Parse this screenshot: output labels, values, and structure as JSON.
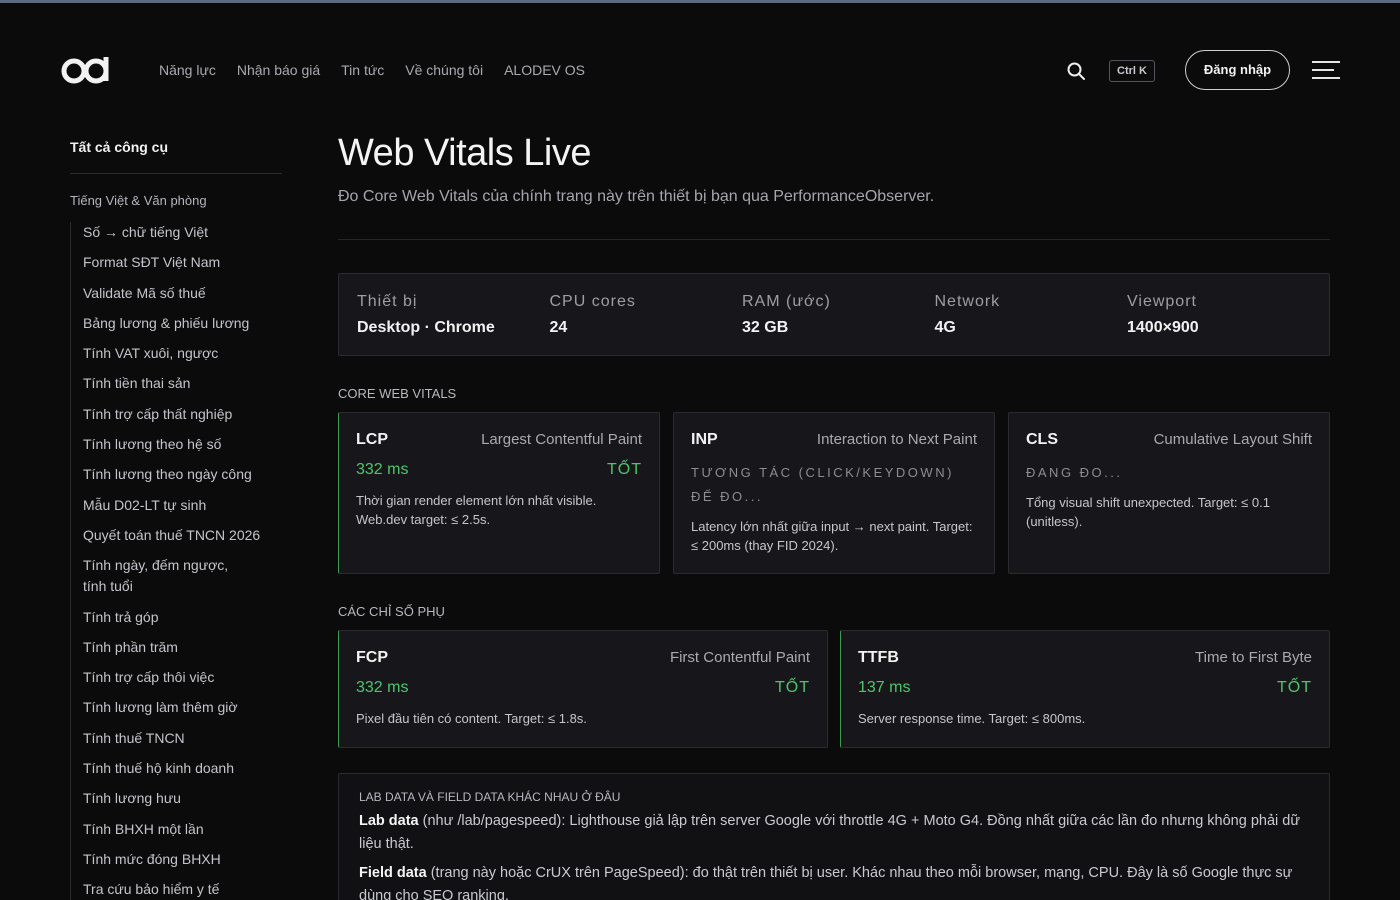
{
  "nav": {
    "items": [
      "Năng lực",
      "Nhận báo giá",
      "Tin tức",
      "Về chúng tôi",
      "ALODEV OS"
    ],
    "shortcut": "Ctrl K",
    "login": "Đăng nhập"
  },
  "sidebar": {
    "title": "Tất cả công cụ",
    "group": "Tiếng Việt & Văn phòng",
    "items": [
      "Số → chữ tiếng Việt",
      "Format SĐT Việt Nam",
      "Validate Mã số thuế",
      "Bảng lương & phiếu lương",
      "Tính VAT xuôi, ngược",
      "Tính tiền thai sản",
      "Tính trợ cấp thất nghiệp",
      "Tính lương theo hệ số",
      "Tính lương theo ngày công",
      "Mẫu D02-LT tự sinh",
      "Quyết toán thuế TNCN 2026",
      "Tính ngày, đếm ngược, tính tuổi",
      "Tính trả góp",
      "Tính phần trăm",
      "Tính trợ cấp thôi việc",
      "Tính lương làm thêm giờ",
      "Tính thuế TNCN",
      "Tính thuế hộ kinh doanh",
      "Tính lương hưu",
      "Tính BHXH một lần",
      "Tính mức đóng BHXH",
      "Tra cứu bảo hiểm y tế"
    ]
  },
  "page": {
    "title": "Web Vitals Live",
    "subtitle": "Đo Core Web Vitals của chính trang này trên thiết bị bạn qua PerformanceObserver."
  },
  "device": [
    {
      "label": "Thiết bị",
      "value": "Desktop · Chrome"
    },
    {
      "label": "CPU cores",
      "value": "24"
    },
    {
      "label": "RAM (ước)",
      "value": "32 GB"
    },
    {
      "label": "Network",
      "value": "4G"
    },
    {
      "label": "Viewport",
      "value": "1400×900"
    }
  ],
  "cwv": {
    "label": "CORE WEB VITALS",
    "lcp": {
      "abbr": "LCP",
      "name": "Largest Contentful Paint",
      "value": "332 ms",
      "status": "TỐT",
      "desc": "Thời gian render element lớn nhất visible. Web.dev target: ≤ 2.5s."
    },
    "inp": {
      "abbr": "INP",
      "name": "Interaction to Next Paint",
      "measuring": "TƯƠNG TÁC (CLICK/KEYDOWN) ĐỂ ĐO...",
      "desc": "Latency lớn nhất giữa input → next paint. Target: ≤ 200ms (thay FID 2024)."
    },
    "cls": {
      "abbr": "CLS",
      "name": "Cumulative Layout Shift",
      "measuring": "ĐANG ĐO...",
      "desc": "Tổng visual shift unexpected. Target: ≤ 0.1 (unitless)."
    }
  },
  "extra": {
    "label": "CÁC CHỈ SỐ PHỤ",
    "fcp": {
      "abbr": "FCP",
      "name": "First Contentful Paint",
      "value": "332 ms",
      "status": "TỐT",
      "desc": "Pixel đầu tiên có content. Target: ≤ 1.8s."
    },
    "ttfb": {
      "abbr": "TTFB",
      "name": "Time to First Byte",
      "value": "137 ms",
      "status": "TỐT",
      "desc": "Server response time. Target: ≤ 800ms."
    }
  },
  "info": {
    "title": "LAB DATA VÀ FIELD DATA KHÁC NHAU Ở ĐÂU",
    "lab_term": "Lab data",
    "lab_text": " (như /lab/pagespeed): Lighthouse giả lập trên server Google với throttle 4G + Moto G4. Đồng nhất giữa các lần đo nhưng không phải dữ liệu thật.",
    "field_term": "Field data",
    "field_text": " (trang này hoặc CrUX trên PageSpeed): đo thật trên thiết bị user. Khác nhau theo mỗi browser, mạng, CPU. Đây là số Google thực sự dùng cho SEO ranking."
  },
  "colors": {
    "good": "#4cc66a",
    "accent_border": "#3c9b55"
  }
}
